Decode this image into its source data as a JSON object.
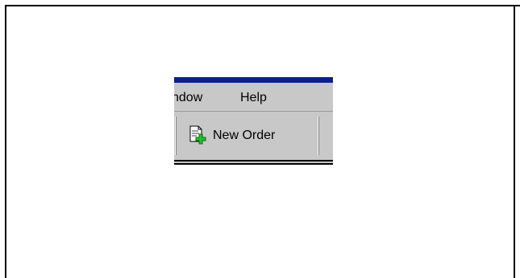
{
  "menu": {
    "window_label": "ndow",
    "help_label": "Help"
  },
  "toolbar": {
    "new_order_label": "New Order",
    "new_order_icon": "new-document-plus-icon"
  },
  "colors": {
    "title_bar": "#0a1f8f",
    "chrome": "#c8c8c8",
    "plus_green": "#22c22c"
  }
}
